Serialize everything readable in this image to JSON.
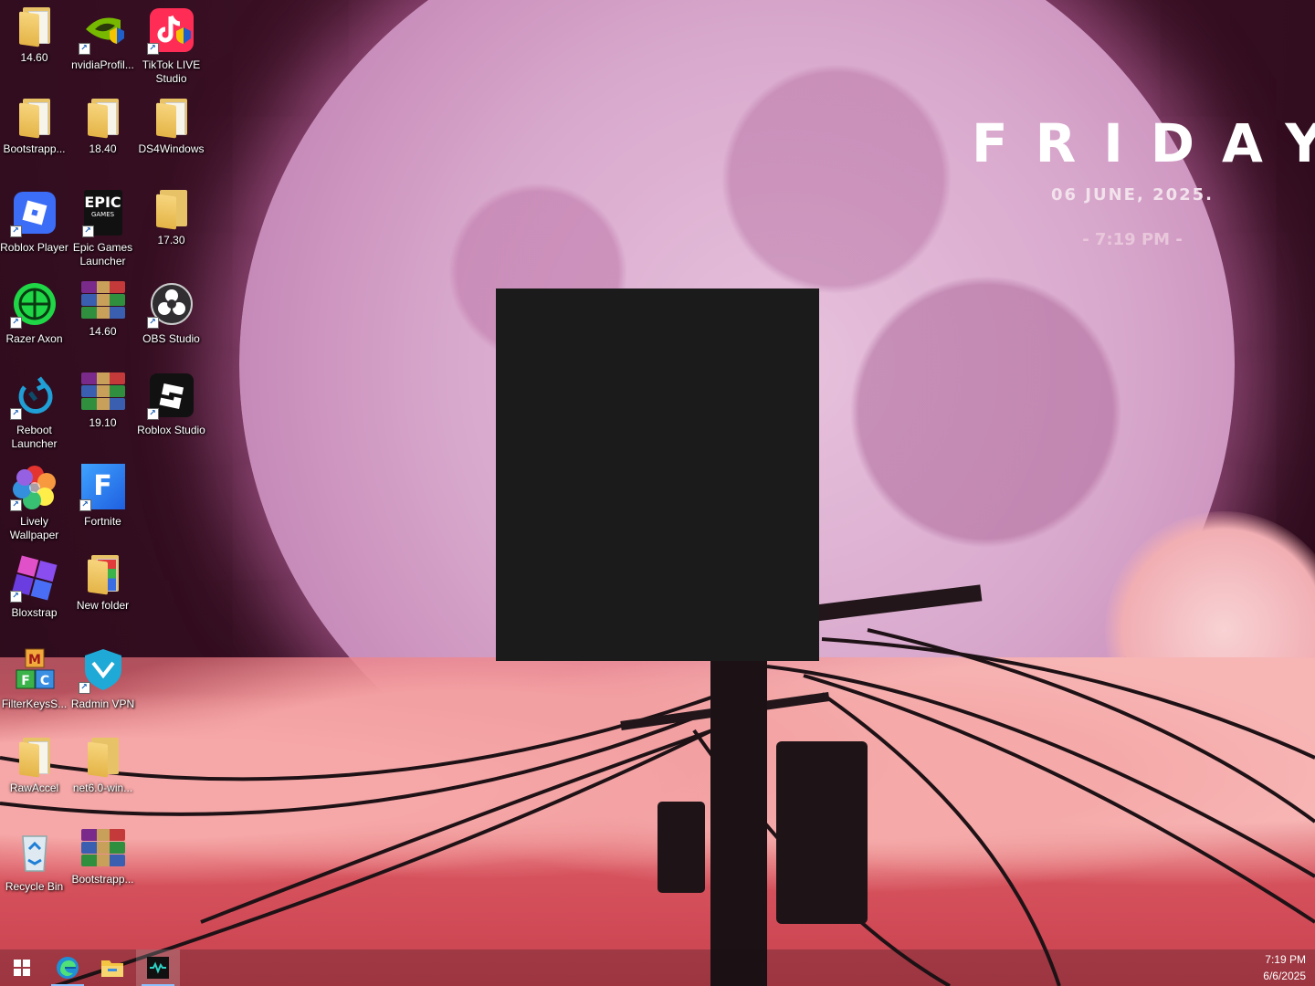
{
  "desktop": {
    "icons": [
      {
        "label": "14.60",
        "type": "folder"
      },
      {
        "label": "nvidiaProfil...",
        "type": "app"
      },
      {
        "label": "TikTok LIVE Studio",
        "type": "app"
      },
      {
        "label": "Bootstrapp...",
        "type": "folder"
      },
      {
        "label": "18.40",
        "type": "folder"
      },
      {
        "label": "DS4Windows",
        "type": "folder"
      },
      {
        "label": "Roblox Player",
        "type": "app"
      },
      {
        "label": "Epic Games Launcher",
        "type": "app"
      },
      {
        "label": "17.30",
        "type": "folder"
      },
      {
        "label": "Razer Axon",
        "type": "app"
      },
      {
        "label": "14.60",
        "type": "archive"
      },
      {
        "label": "OBS Studio",
        "type": "app"
      },
      {
        "label": "Reboot Launcher",
        "type": "app"
      },
      {
        "label": "19.10",
        "type": "archive"
      },
      {
        "label": "Roblox Studio",
        "type": "app"
      },
      {
        "label": "Lively Wallpaper",
        "type": "app"
      },
      {
        "label": "Fortnite",
        "type": "app"
      },
      {
        "label": "Bloxstrap",
        "type": "app"
      },
      {
        "label": "New folder",
        "type": "folder"
      },
      {
        "label": "FilterKeysS...",
        "type": "app"
      },
      {
        "label": "Radmin VPN",
        "type": "app"
      },
      {
        "label": "RawAccel",
        "type": "folder"
      },
      {
        "label": "net6.0-win...",
        "type": "folder"
      },
      {
        "label": "Recycle Bin",
        "type": "app"
      },
      {
        "label": "Bootstrapp...",
        "type": "archive"
      }
    ],
    "epic_logo_text": "EPIC",
    "epic_logo_sub": "GAMES",
    "fortnite_letter": "F",
    "filterkeys_letters": [
      "M",
      "F",
      "C"
    ]
  },
  "widget": {
    "day": "FRIDAY",
    "date": "06  JUNE, 2025.",
    "time": "- 7:19 PM -"
  },
  "taskbar": {
    "buttons": [
      "windows-start",
      "edge",
      "file-explorer",
      "wallpaper-app"
    ],
    "clock_time": "7:19 PM",
    "clock_date": "6/6/2025"
  },
  "colors": {
    "accent": "#8cc0ff",
    "overlay": "#1b1b1b"
  }
}
